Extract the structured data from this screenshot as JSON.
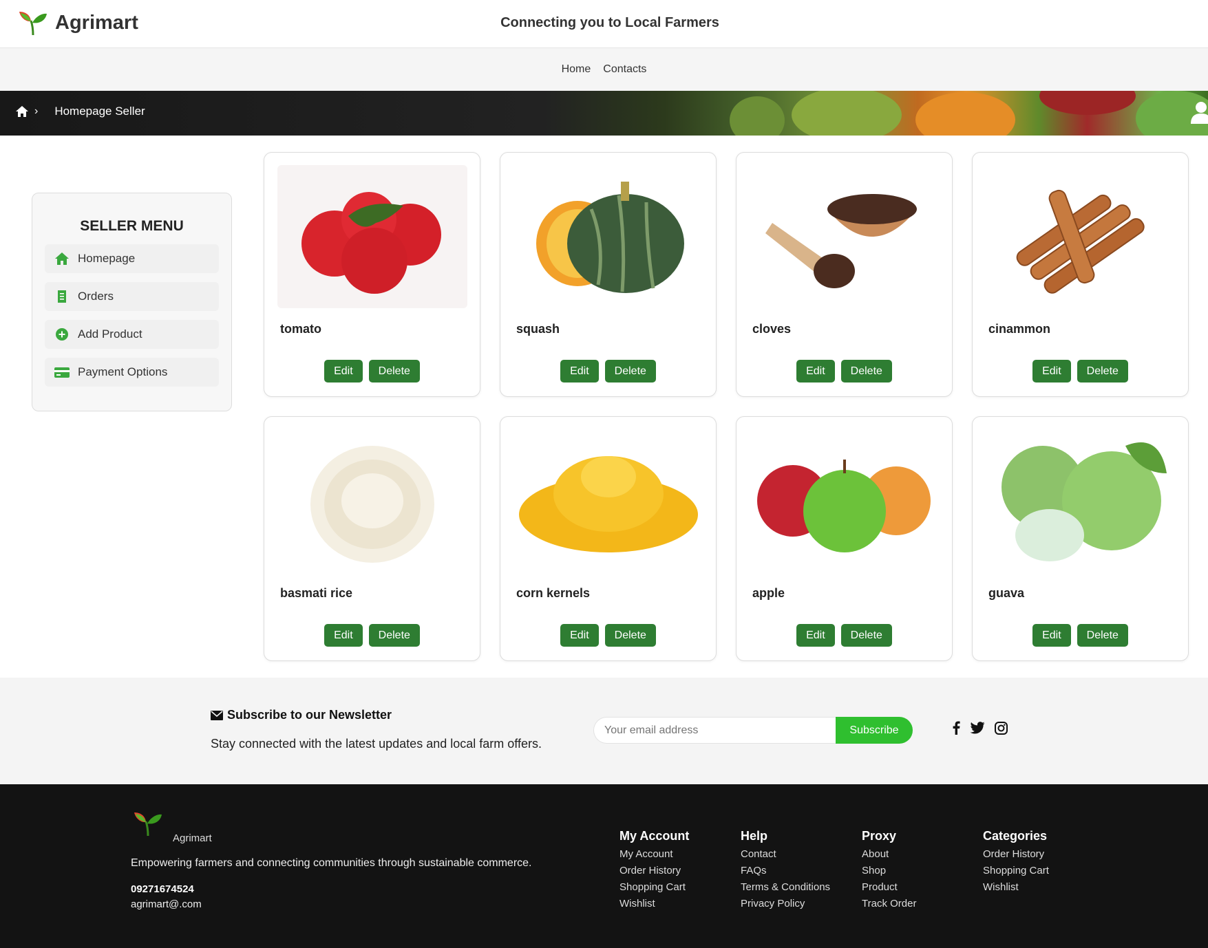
{
  "header": {
    "brand": "Agrimart",
    "tagline": "Connecting you to Local Farmers"
  },
  "nav": {
    "items": [
      {
        "label": "Home"
      },
      {
        "label": "Contacts"
      }
    ]
  },
  "breadcrumb": {
    "separator": "›",
    "current": "Homepage Seller"
  },
  "sidebar": {
    "title": "SELLER MENU",
    "items": [
      {
        "label": "Homepage",
        "icon": "home-icon"
      },
      {
        "label": "Orders",
        "icon": "receipt-icon"
      },
      {
        "label": "Add Product",
        "icon": "plus-circle-icon"
      },
      {
        "label": "Payment Options",
        "icon": "credit-card-icon"
      }
    ]
  },
  "products": [
    {
      "name": "tomato",
      "edit": "Edit",
      "delete": "Delete"
    },
    {
      "name": "squash",
      "edit": "Edit",
      "delete": "Delete"
    },
    {
      "name": "cloves",
      "edit": "Edit",
      "delete": "Delete"
    },
    {
      "name": "cinammon",
      "edit": "Edit",
      "delete": "Delete"
    },
    {
      "name": "basmati rice",
      "edit": "Edit",
      "delete": "Delete"
    },
    {
      "name": "corn kernels",
      "edit": "Edit",
      "delete": "Delete"
    },
    {
      "name": "apple",
      "edit": "Edit",
      "delete": "Delete"
    },
    {
      "name": "guava",
      "edit": "Edit",
      "delete": "Delete"
    }
  ],
  "newsletter": {
    "title": "Subscribe to our Newsletter",
    "subtitle": "Stay connected with the latest updates and local farm offers.",
    "placeholder": "Your email address",
    "button": "Subscribe",
    "socials": [
      "facebook-icon",
      "twitter-icon",
      "instagram-icon"
    ]
  },
  "footer": {
    "brand": "Agrimart",
    "description": "Empowering farmers and connecting communities through sustainable commerce.",
    "phone": "09271674524",
    "email": "agrimart@.com",
    "columns": [
      {
        "title": "My Account",
        "links": [
          "My Account",
          "Order History",
          "Shopping Cart",
          "Wishlist"
        ]
      },
      {
        "title": "Help",
        "links": [
          "Contact",
          "FAQs",
          "Terms & Conditions",
          "Privacy Policy"
        ]
      },
      {
        "title": "Proxy",
        "links": [
          "About",
          "Shop",
          "Product",
          "Track Order"
        ]
      },
      {
        "title": "Categories",
        "links": [
          "Order History",
          "Shopping Cart",
          "Wishlist"
        ]
      }
    ]
  },
  "colors": {
    "accent": "#2e7d32",
    "subscribe": "#2fbf2f",
    "footer_bg": "#131313"
  }
}
